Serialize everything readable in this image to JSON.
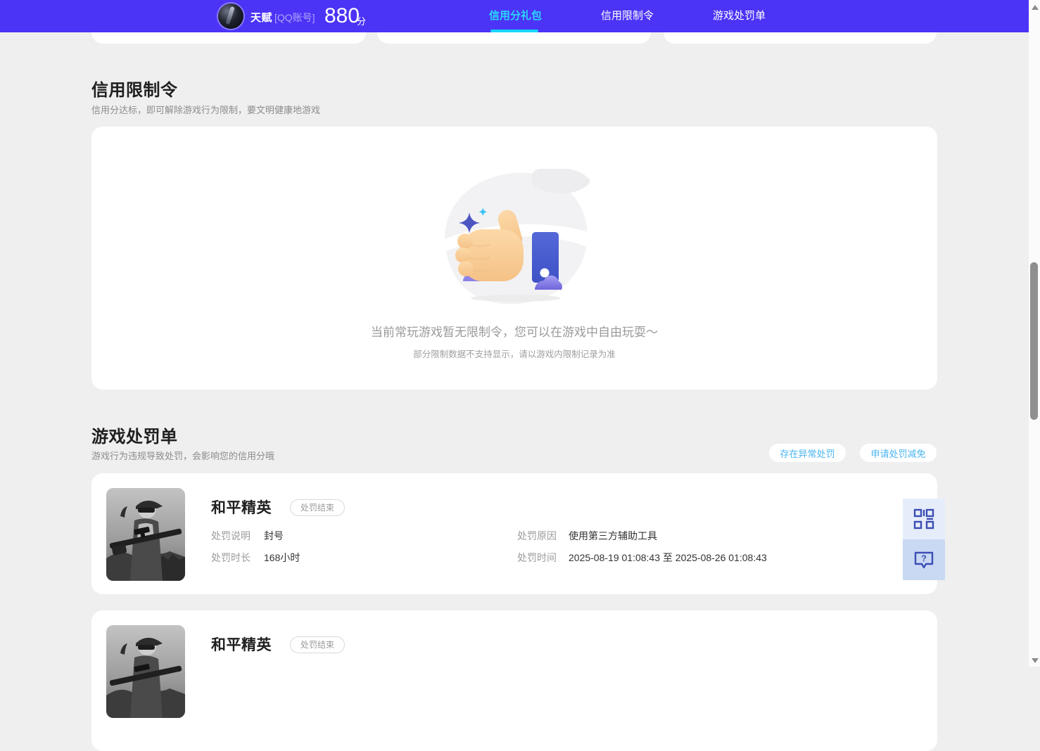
{
  "header": {
    "user": {
      "name": "天赋",
      "account_type": "[QQ账号]",
      "score": "880",
      "score_unit": "分"
    },
    "tabs": [
      {
        "label": "信用分礼包",
        "active": true
      },
      {
        "label": "信用限制令",
        "active": false
      },
      {
        "label": "游戏处罚单",
        "active": false
      }
    ]
  },
  "restriction_section": {
    "title": "信用限制令",
    "subtitle": "信用分达标，即可解除游戏行为限制，要文明健康地游戏",
    "empty_state": {
      "message": "当前常玩游戏暂无限制令，您可以在游戏中自由玩耍～",
      "note": "部分限制数据不支持显示，请以游戏内限制记录为准"
    }
  },
  "penalty_section": {
    "title": "游戏处罚单",
    "subtitle": "游戏行为违规导致处罚，会影响您的信用分哦",
    "actions": [
      {
        "label": "存在异常处罚"
      },
      {
        "label": "申请处罚减免"
      }
    ],
    "cards": [
      {
        "game": "和平精英",
        "status": "处罚结束",
        "fields": [
          {
            "label": "处罚说明",
            "value": "封号"
          },
          {
            "label": "处罚原因",
            "value": "使用第三方辅助工具"
          },
          {
            "label": "处罚时长",
            "value": "168小时"
          },
          {
            "label": "处罚时间",
            "value": "2025-08-19 01:08:43 至 2025-08-26 01:08:43"
          }
        ]
      },
      {
        "game": "和平精英",
        "status": "处罚结束"
      }
    ]
  },
  "icons": {
    "qr": "qr-code-icon",
    "help": "question-bubble-icon",
    "scroll_up": "scrollbar-up-arrow",
    "scroll_down": "scrollbar-down-arrow",
    "illustration": "thumbs-up-illustration"
  },
  "colors": {
    "header_bg": "#4b34f6",
    "active_tab": "#29d7ff",
    "page_bg": "#efefef",
    "card_bg": "#ffffff",
    "action_text": "#49b4f0",
    "label_gray": "#9b9b9b",
    "value_dark": "#333333",
    "float_qr_bg": "#e6edfa",
    "float_help_bg": "#c9d9f4",
    "float_icon": "#3c4eb4"
  }
}
